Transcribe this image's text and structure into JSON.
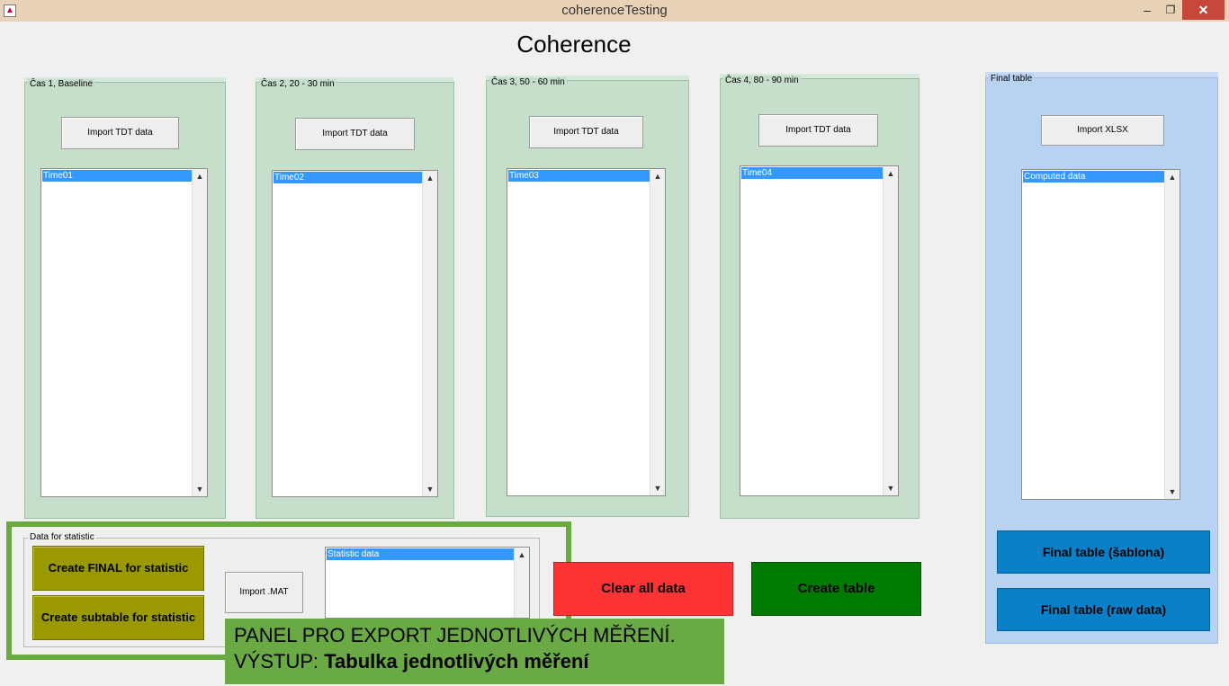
{
  "window": {
    "title": "coherenceTesting",
    "minimize": "–",
    "maximize": "❐",
    "close": "✕"
  },
  "page_title": "Coherence",
  "time_panels": [
    {
      "label": "Čas 1, Baseline",
      "import_label": "Import TDT data",
      "list_item": "Time01"
    },
    {
      "label": "Čas 2, 20 - 30 min",
      "import_label": "Import TDT data",
      "list_item": "Time02"
    },
    {
      "label": "Čas 3, 50 - 60 min",
      "import_label": "Import TDT data",
      "list_item": "Time03"
    },
    {
      "label": "Čas 4, 80 - 90 min",
      "import_label": "Import TDT data",
      "list_item": "Time04"
    }
  ],
  "final_table": {
    "label": "Final table",
    "import_label": "Import XLSX",
    "list_item": "Computed data",
    "btn_sablona": "Final table (šablona)",
    "btn_raw": "Final table (raw data)"
  },
  "statistic": {
    "label": "Data for statistic",
    "create_final": "Create FINAL for statistic",
    "create_subtable": "Create subtable for statistic",
    "import_mat": "Import .MAT",
    "list_item": "Statistic data"
  },
  "actions": {
    "clear_all": "Clear all data",
    "create_table": "Create table"
  },
  "annotation": {
    "line1": "PANEL PRO EXPORT JEDNOTLIVÝCH MĚŘENÍ.",
    "line2_prefix": "VÝSTUP: ",
    "line2_bold": "Tabulka jednotlivých měření"
  },
  "colors": {
    "panel_green": "#c5dfca",
    "final_blue": "#b8d2f2",
    "button_blue": "#0a80c8",
    "button_olive": "#9a9a00",
    "clear_red": "#ff3333",
    "create_green": "#007a00",
    "highlight_green": "#6aa842",
    "selection": "#3399ff"
  }
}
